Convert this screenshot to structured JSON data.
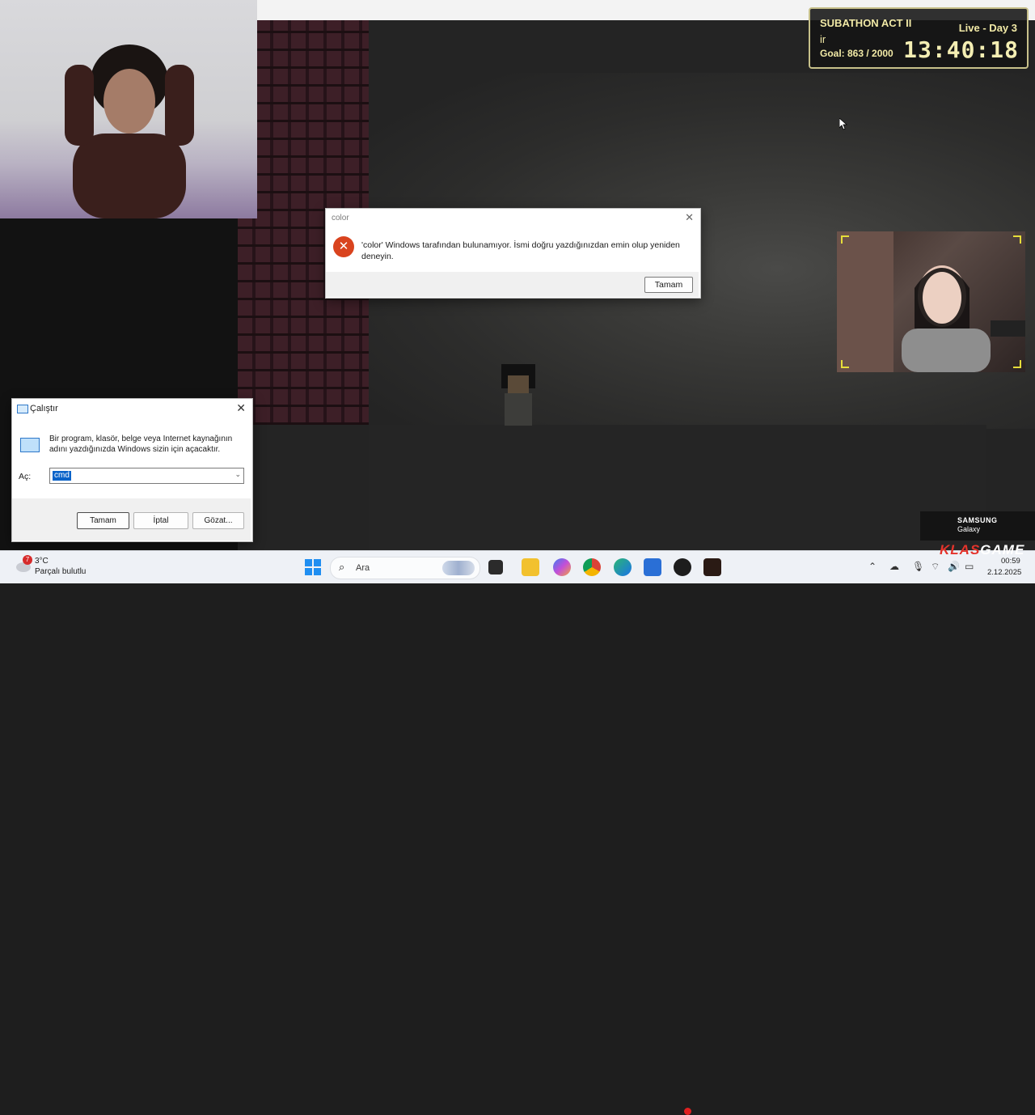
{
  "overlay": {
    "event_title": "SUBATHON ACT II",
    "status": "Live - Day 3",
    "sub_label": "ir",
    "goal": "Goal: 863 / 2000",
    "timer": "13:40:18"
  },
  "error_dialog": {
    "title": "color",
    "message": "'color' Windows tarafından bulunamıyor. İsmi doğru yazdığınızdan emin olup yeniden deneyin.",
    "ok_button": "Tamam",
    "icon": "error-x-icon"
  },
  "run_dialog": {
    "title": "Çalıştır",
    "description": "Bir program, klasör, belge veya Internet kaynağının adını yazdığınızda Windows sizin için açacaktır.",
    "open_label": "Aç:",
    "input_value": "cmd",
    "buttons": {
      "ok": "Tamam",
      "cancel": "İptal",
      "browse": "Gözat..."
    }
  },
  "taskbar": {
    "weather_badge": "7",
    "weather_temp": "3°C",
    "weather_condition": "Parçalı bulutlu",
    "search_placeholder": "Ara",
    "time": "00:59",
    "date": "2.12.2025"
  },
  "sponsor": {
    "brand": "SAMSUNG",
    "product": "Galaxy",
    "logo_text_a": "KLAS",
    "logo_text_b": "GAME"
  },
  "colors": {
    "error_red": "#d9431e",
    "selection_blue": "#0a63c9",
    "overlay_text": "#f1e9a6"
  }
}
